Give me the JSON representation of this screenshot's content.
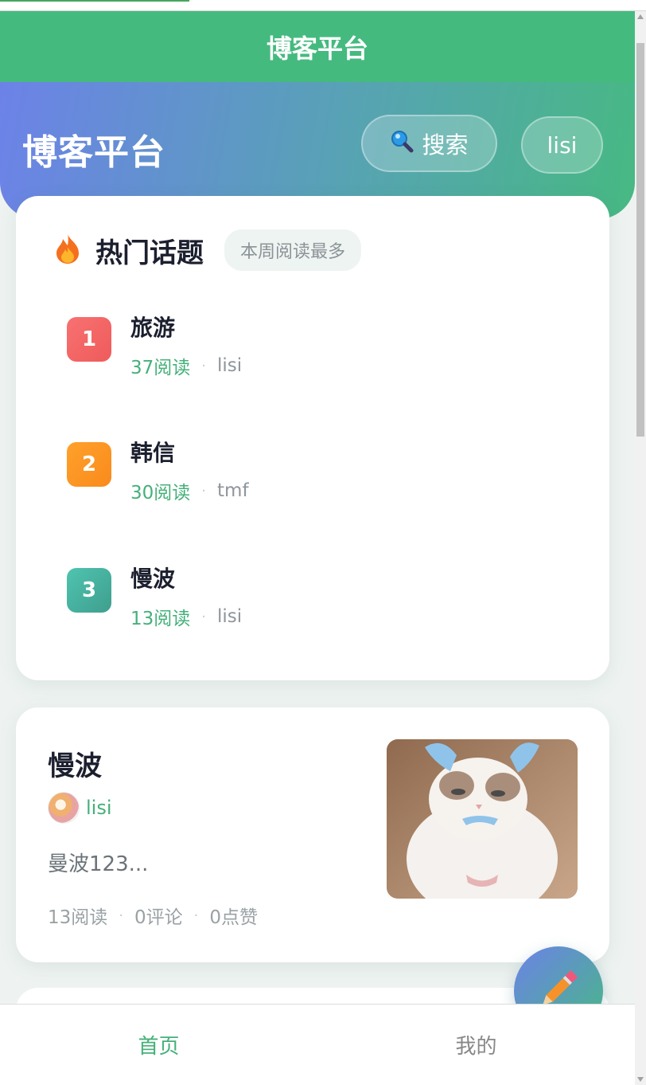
{
  "navbar": {
    "title": "博客平台"
  },
  "hero": {
    "title": "博客平台",
    "search_label": "搜索",
    "search_icon": "magnifier-icon",
    "user_label": "lisi"
  },
  "hot": {
    "icon": "fire-icon",
    "title": "热门话题",
    "badge": "本周阅读最多",
    "items": [
      {
        "rank": "1",
        "title": "旅游",
        "reads": "37阅读",
        "dot": "·",
        "author": "lisi",
        "color": "#f26464"
      },
      {
        "rank": "2",
        "title": "韩信",
        "reads": "30阅读",
        "dot": "·",
        "author": "tmf",
        "color": "#fd9622"
      },
      {
        "rank": "3",
        "title": "慢波",
        "reads": "13阅读",
        "dot": "·",
        "author": "lisi",
        "color": "#45aa99"
      }
    ]
  },
  "post": {
    "title": "慢波",
    "author": "lisi",
    "excerpt": "曼波123...",
    "reads": "13阅读",
    "comments": "0评论",
    "likes": "0点赞",
    "dot": "·"
  },
  "fab": {
    "icon": "pencil-icon"
  },
  "tabbar": {
    "home": "首页",
    "mine": "我的"
  },
  "colors": {
    "accent": "#45ba7f",
    "gradient_start": "#6c82e8",
    "text_dark": "#1c1f2e"
  }
}
